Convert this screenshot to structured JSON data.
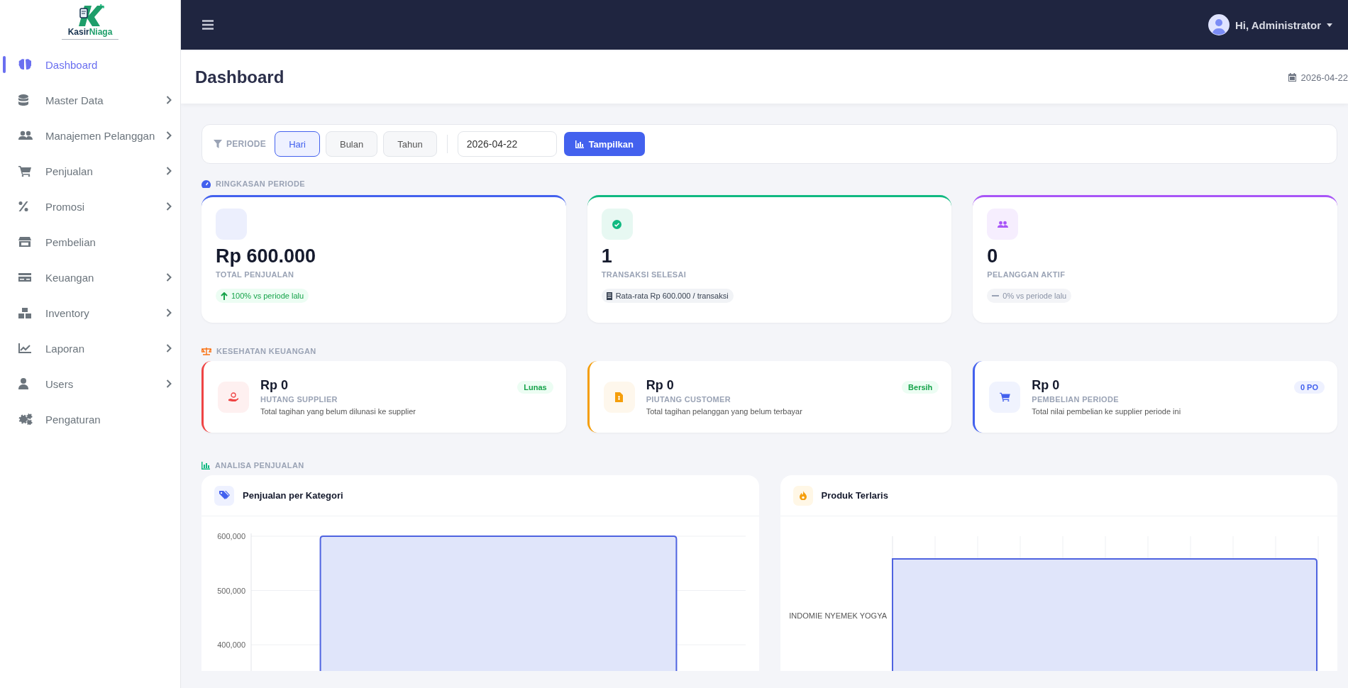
{
  "sidebar": {
    "logo": {
      "brand_part_1": "Kasir",
      "brand_part_2": "Niaga"
    },
    "items": [
      {
        "label": "Dashboard",
        "selected": true,
        "has_submenu": false
      },
      {
        "label": "Master Data",
        "selected": false,
        "has_submenu": true
      },
      {
        "label": "Manajemen Pelanggan",
        "selected": false,
        "has_submenu": true
      },
      {
        "label": "Penjualan",
        "selected": false,
        "has_submenu": true
      },
      {
        "label": "Promosi",
        "selected": false,
        "has_submenu": true
      },
      {
        "label": "Pembelian",
        "selected": false,
        "has_submenu": false
      },
      {
        "label": "Keuangan",
        "selected": false,
        "has_submenu": true
      },
      {
        "label": "Inventory",
        "selected": false,
        "has_submenu": true
      },
      {
        "label": "Laporan",
        "selected": false,
        "has_submenu": true
      },
      {
        "label": "Users",
        "selected": false,
        "has_submenu": true
      },
      {
        "label": "Pengaturan",
        "selected": false,
        "has_submenu": false
      }
    ]
  },
  "topbar": {
    "user_greeting": "Hi, Administrator"
  },
  "header": {
    "title": "Dashboard",
    "date": "2026-04-22"
  },
  "filter": {
    "label": "PERIODE",
    "periods": [
      {
        "label": "Hari",
        "selected": true
      },
      {
        "label": "Bulan",
        "selected": false
      },
      {
        "label": "Tahun",
        "selected": false
      }
    ],
    "date_value": "2026-04-22",
    "submit": "Tampilkan"
  },
  "summary": {
    "title": "RINGKASAN PERIODE",
    "cards": [
      {
        "kind": "sales",
        "value": "Rp 600.000",
        "label": "TOTAL PENJUALAN",
        "note": {
          "kind": "up",
          "text": "100% vs periode lalu"
        },
        "color": "#4361ee"
      },
      {
        "kind": "transactions",
        "value": "1",
        "label": "TRANSAKSI SELESAI",
        "note": {
          "kind": "info",
          "text": "Rata-rata Rp 600.000 / transaksi"
        },
        "color": "#10b981"
      },
      {
        "kind": "customers",
        "value": "0",
        "label": "PELANGGAN AKTIF",
        "note": {
          "kind": "flat",
          "text": "0% vs periode lalu"
        },
        "color": "#a855f7"
      }
    ]
  },
  "health": {
    "title": "KESEHATAN KEUANGAN",
    "cards": [
      {
        "kind": "payable",
        "value": "Rp 0",
        "label": "HUTANG SUPPLIER",
        "description": "Total tagihan yang belum dilunasi ke supplier",
        "badge": {
          "kind": "success",
          "text": "Lunas"
        },
        "color": "#ef4444"
      },
      {
        "kind": "receivable",
        "value": "Rp 0",
        "label": "PIUTANG CUSTOMER",
        "description": "Total tagihan pelanggan yang belum terbayar",
        "badge": {
          "kind": "success",
          "text": "Bersih"
        },
        "color": "#f59e0b"
      },
      {
        "kind": "purchase",
        "value": "Rp 0",
        "label": "PEMBELIAN PERIODE",
        "description": "Total nilai pembelian ke supplier periode ini",
        "badge": {
          "kind": "info",
          "text": "0 PO"
        },
        "color": "#4361ee"
      }
    ]
  },
  "analysis": {
    "title": "ANALISA PENJUALAN",
    "charts": [
      {
        "kind": "category",
        "title": "Penjualan per Kategori",
        "axis_labels": [
          "600,000",
          "500,000",
          "400,000"
        ]
      },
      {
        "kind": "products",
        "title": "Produk Terlaris",
        "bar_labels": [
          "INDOMIE NYEMEK YOGYA"
        ]
      }
    ]
  }
}
